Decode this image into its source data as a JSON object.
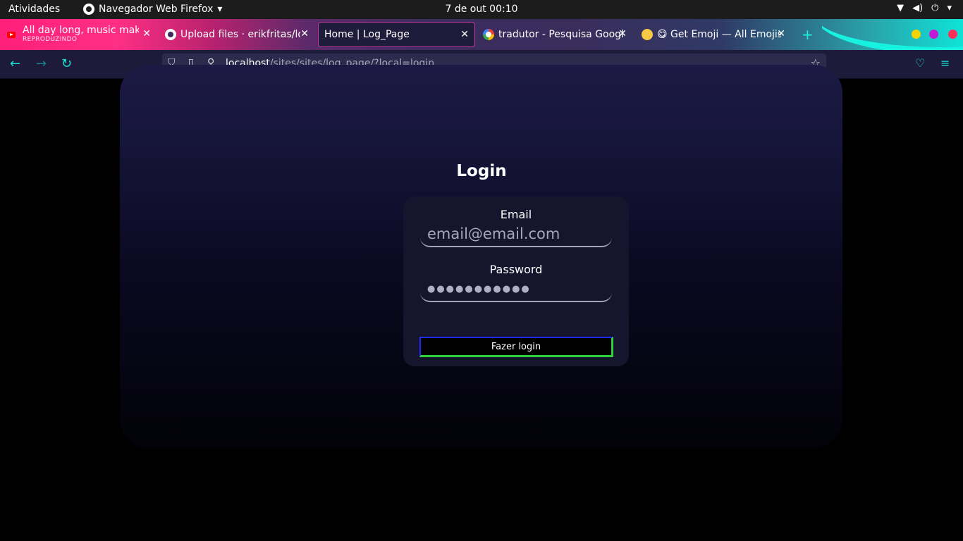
{
  "topbar": {
    "activities": "Atividades",
    "app_name": "Navegador Web Firefox",
    "clock": "7 de out  00:10"
  },
  "tabs": [
    {
      "title": "All day long, music makes",
      "subtitle": "REPRODUZINDO",
      "icon": "youtube-icon"
    },
    {
      "title": "Upload files · erikfritas/lo",
      "icon": "github-icon"
    },
    {
      "title": "Home | Log_Page",
      "icon": "none",
      "active": true
    },
    {
      "title": "tradutor - Pesquisa Googl",
      "icon": "google-icon"
    },
    {
      "title": "😋 Get Emoji — All Emojis",
      "icon": "emoji-icon"
    }
  ],
  "window_controls": {
    "colors": [
      "#f5d300",
      "#c21bd6",
      "#ff2f5a"
    ]
  },
  "url": {
    "host": "localhost",
    "path": "/sites/sites/log_page/?local=login"
  },
  "login": {
    "title": "Login",
    "email_label": "Email",
    "email_placeholder": "email@email.com",
    "password_label": "Password",
    "password_value": "●●●●●●●●●●●",
    "submit_label": "Fazer login"
  },
  "colors": {
    "accent": "#19e0d6",
    "button_border_top": "#1f2aff",
    "button_border_bottom": "#2fd13a"
  }
}
